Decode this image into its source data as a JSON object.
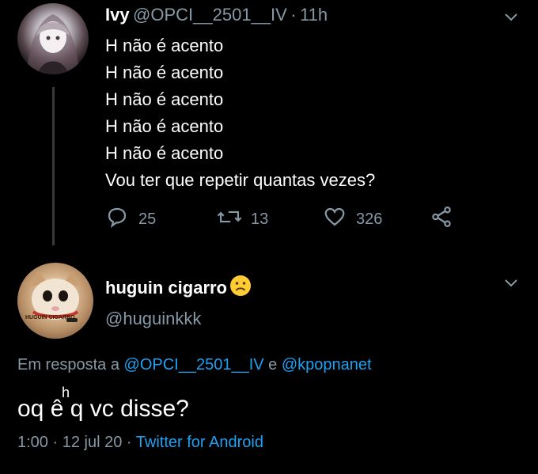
{
  "parent_tweet": {
    "name": "Ivy",
    "handle": "@OPCI__2501__IV",
    "time": "11h",
    "lines": [
      "H não é acento",
      "H não é acento",
      "H não é acento",
      "H não é acento",
      "H não é acento",
      "Vou ter que repetir quantas vezes?"
    ],
    "replies": "25",
    "retweets": "13",
    "likes": "326"
  },
  "reply_tweet": {
    "name": "huguin cigarro",
    "emoji": "☹",
    "handle": "@huguinkkk",
    "avatar_caption": "HUGUIN CIGARRO",
    "reply_prefix": "Em resposta a",
    "reply_mention1": "@OPCI__2501__IV",
    "reply_joiner": "e",
    "reply_mention2": "@kpopnanet",
    "text_before": "oq ",
    "text_accent": "ê",
    "text_after": " q vc disse?",
    "accent_over": "h",
    "time": "1:00",
    "date": "12 jul 20",
    "source": "Twitter for Android"
  },
  "icons": [
    "reply-icon",
    "retweet-icon",
    "like-icon",
    "share-icon",
    "chevron-down-icon"
  ],
  "colors": {
    "background": "#000000",
    "muted": "#8899a6",
    "link": "#1da1f2",
    "text": "#ffffff"
  }
}
